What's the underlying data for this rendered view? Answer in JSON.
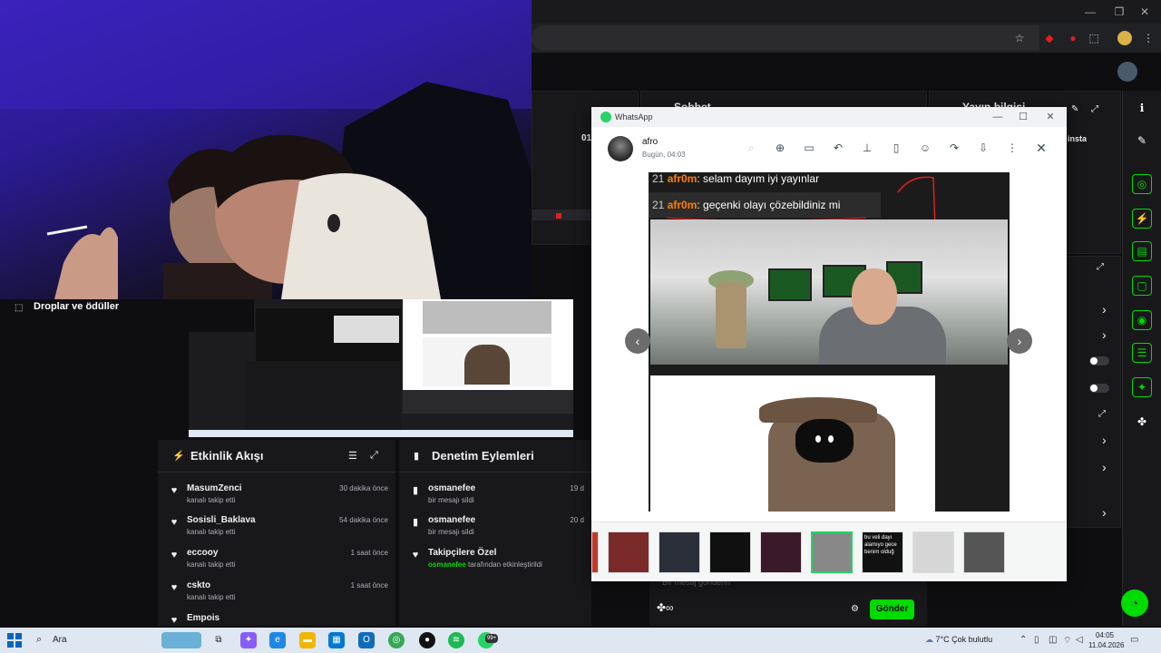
{
  "whatsapp": {
    "window_title": "WhatsApp",
    "contact_name": "afro",
    "timestamp": "Bugün, 04:03",
    "image_chat": [
      {
        "num": "21",
        "user": "afr0m",
        "text": ": selam dayım iyi yayınlar"
      },
      {
        "num": "21",
        "user": "afr0m",
        "text": ": geçenki olayı çözebildiniz mi"
      }
    ],
    "thumb_caption": "bu veli dayı alamıyo gece benim olduğ"
  },
  "drops": {
    "label": "Droplar ve ödüller"
  },
  "activity": {
    "title": "Etkinlik Akışı",
    "events": [
      {
        "name": "MasumZenci",
        "sub": "kanalı takip etti",
        "time": "30 dakika önce"
      },
      {
        "name": "Sosisli_Baklava",
        "sub": "kanalı takip etti",
        "time": "54 dakika önce"
      },
      {
        "name": "eccooy",
        "sub": "kanalı takip etti",
        "time": "1 saat önce"
      },
      {
        "name": "cskto",
        "sub": "kanalı takip etti",
        "time": "1 saat önce"
      },
      {
        "name": "Empois",
        "sub": "",
        "time": ""
      }
    ]
  },
  "moderation": {
    "title": "Denetim Eylemleri",
    "events": [
      {
        "name": "osmanefee",
        "sub": "bir mesajı sildi",
        "time": "19 d"
      },
      {
        "name": "osmanefee",
        "sub": "bir mesajı sildi",
        "time": "20 d"
      },
      {
        "name": "Takipçilere Özel",
        "sub_user": "osmanefee",
        "sub": "tarafından etkinleştirildi",
        "time": ""
      }
    ]
  },
  "chat": {
    "placeholder": "Bir mesaj gönderin",
    "send_label": "Gönder"
  },
  "dashboard": {
    "chat_header": "Sohbet",
    "info_header": "Yayın bilgisi",
    "insta": "insta",
    "partial_text": "01"
  },
  "taskbar": {
    "search_placeholder": "Ara",
    "weather": "7°C  Çok bulutlu",
    "time": "04:05",
    "date": "11.04.2026",
    "badge": "99+"
  },
  "colors": {
    "twitch_green": "#00db00",
    "whatsapp_green": "#25d366",
    "chat_name": "#ff7f00"
  }
}
